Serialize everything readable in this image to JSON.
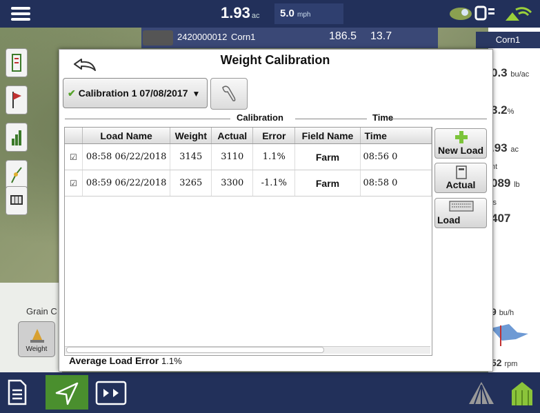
{
  "topbar": {
    "area_value": "1.93",
    "area_unit": "ac",
    "speed_value": "5.0",
    "speed_unit": "mph"
  },
  "vehicle_strip": {
    "field_id": "2420000012",
    "crop": "Corn1",
    "value_1": "186.5",
    "value_2": "13.7"
  },
  "right_panel": {
    "header": "Corn1",
    "item1_value": "0.3",
    "item1_unit": "bu/ac",
    "item2_value": "3.2",
    "item2_unit": "%",
    "item3_value": ".93",
    "item3_unit": "ac",
    "item4_label": "nt",
    "item4_value": "089",
    "item4_unit": "lb",
    "item5_label": "ls",
    "item5_value": "407",
    "item6_value": "9",
    "item6_unit": "bu/h",
    "item7_value": "52",
    "item7_unit": "rpm"
  },
  "grain_panel": {
    "label": "Grain C",
    "weight_button": "Weight"
  },
  "dialog": {
    "title": "Weight Calibration",
    "calibration_select": "Calibration 1 07/08/2017",
    "group_calibration": "Calibration",
    "group_time": "Time",
    "columns": [
      "",
      "Load Name",
      "Weight",
      "Actual",
      "Error",
      "Field Name",
      "Time"
    ],
    "rows": [
      {
        "checked": "☑",
        "load_name": "08:58 06/22/2018",
        "weight": "3145",
        "actual": "3110",
        "error": "1.1%",
        "field_name": "Farm",
        "time": "08:56 0"
      },
      {
        "checked": "☑",
        "load_name": "08:59 06/22/2018",
        "weight": "3265",
        "actual": "3300",
        "error": "-1.1%",
        "field_name": "Farm",
        "time": "08:58 0"
      }
    ],
    "new_load_button": "New Load",
    "actual_button": "Actual",
    "load_button": "Load",
    "average_label": "Average Load Error",
    "average_value": "1.1%"
  },
  "colors": {
    "topbar": "#22305a",
    "accent_green": "#4a8f2e",
    "check_green": "#56a32b"
  }
}
